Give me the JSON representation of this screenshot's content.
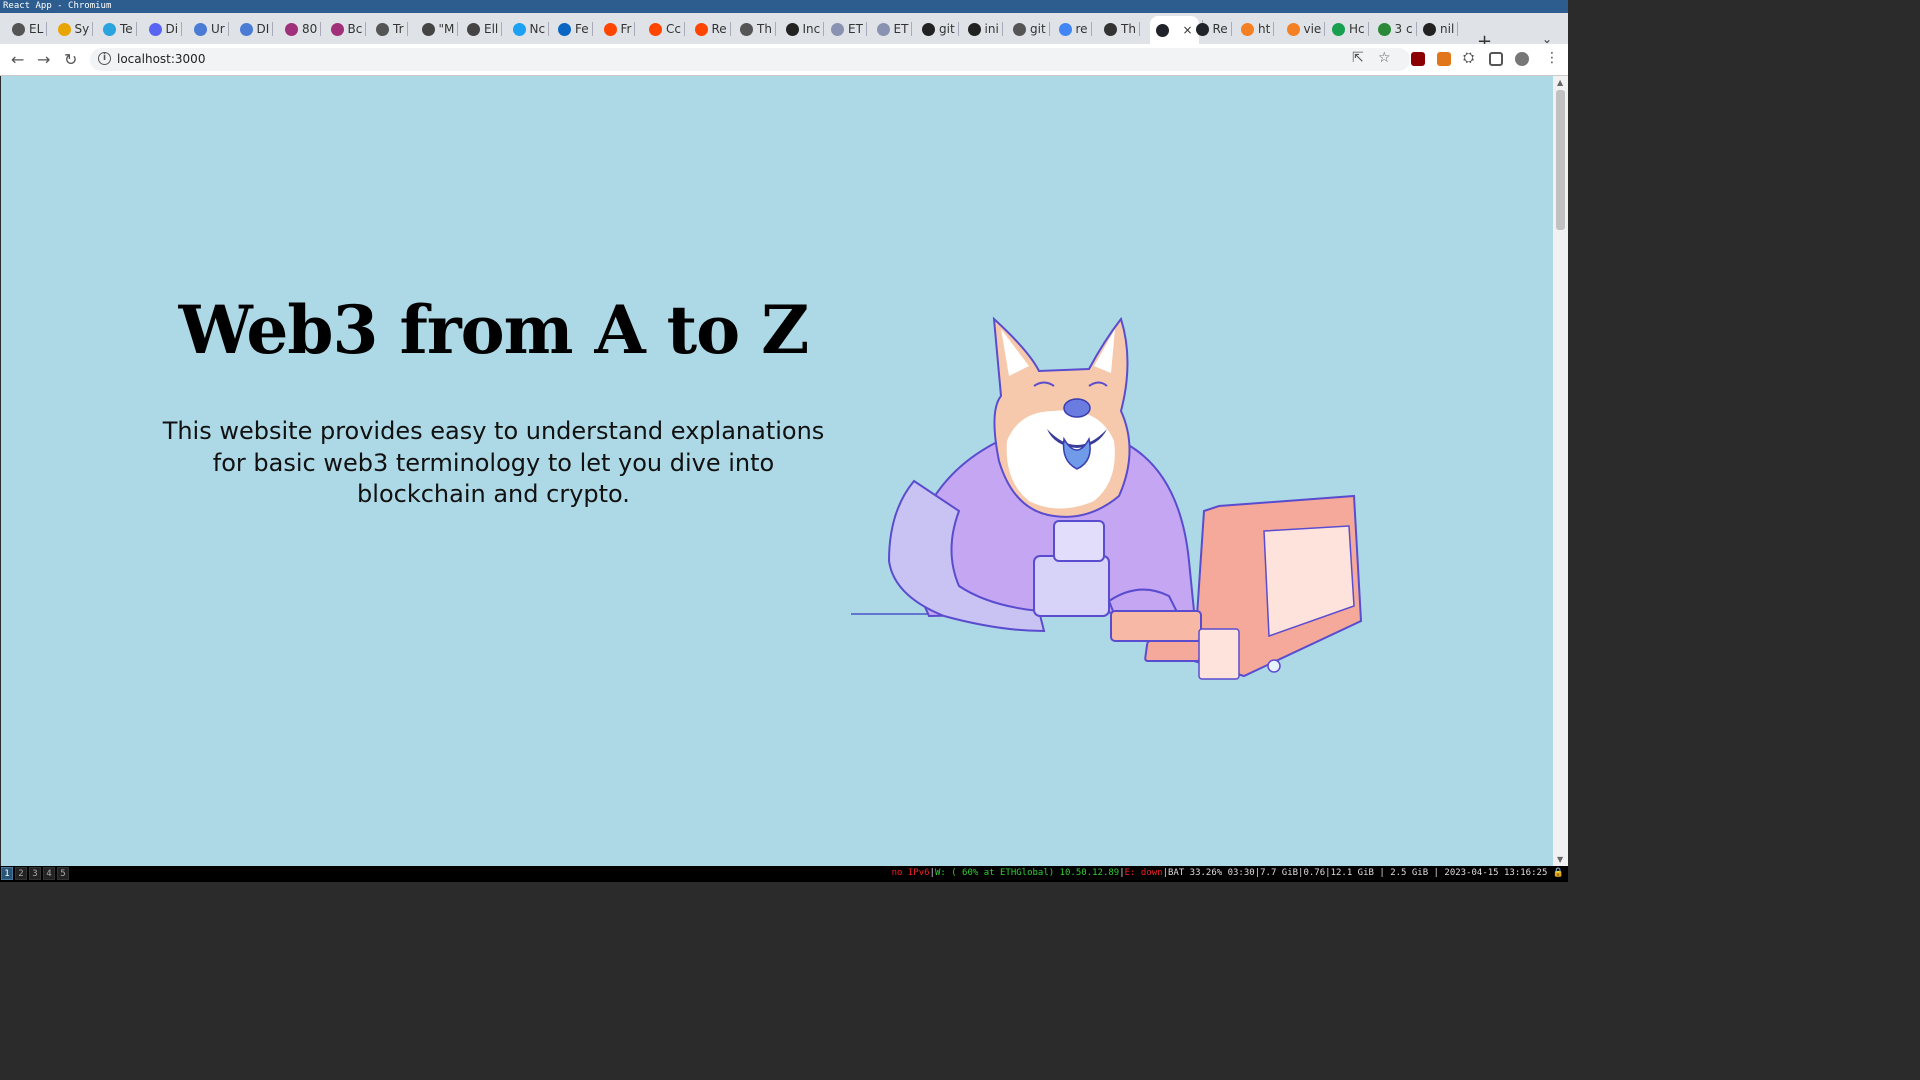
{
  "window": {
    "title": "React App - Chromium"
  },
  "tabs": [
    {
      "label": "EL",
      "fav": "globe-icon"
    },
    {
      "label": "Sy",
      "fav": "bird-icon"
    },
    {
      "label": "Te",
      "fav": "telegram-icon"
    },
    {
      "label": "Di",
      "fav": "discord-icon"
    },
    {
      "label": "Ur",
      "fav": "puzzle-icon"
    },
    {
      "label": "DI",
      "fav": "puzzle-icon"
    },
    {
      "label": "80",
      "fav": "jr-icon"
    },
    {
      "label": "Bc",
      "fav": "jr-icon"
    },
    {
      "label": "Tr",
      "fav": "globe-icon"
    },
    {
      "label": "\"M",
      "fav": "doc-icon"
    },
    {
      "label": "Ell",
      "fav": "doc-icon"
    },
    {
      "label": "Nc",
      "fav": "twitter-icon"
    },
    {
      "label": "Fe",
      "fav": "linkedin-icon"
    },
    {
      "label": "Fr",
      "fav": "reddit-icon"
    },
    {
      "label": "Cc",
      "fav": "reddit-icon"
    },
    {
      "label": "Re",
      "fav": "reddit-icon"
    },
    {
      "label": "Th",
      "fav": "globe-icon"
    },
    {
      "label": "Inc",
      "fav": "github-icon"
    },
    {
      "label": "ET",
      "fav": "eth-icon"
    },
    {
      "label": "ET",
      "fav": "eth-icon"
    },
    {
      "label": "git",
      "fav": "github-icon"
    },
    {
      "label": "ini",
      "fav": "github-icon"
    },
    {
      "label": "git",
      "fav": "globe-icon"
    },
    {
      "label": "re",
      "fav": "google-icon"
    },
    {
      "label": "Th",
      "fav": "a-icon"
    },
    {
      "label": "",
      "fav": "react-icon",
      "active": true
    },
    {
      "label": "Re",
      "fav": "react-icon"
    },
    {
      "label": "ht",
      "fav": "stack-icon"
    },
    {
      "label": "vie",
      "fav": "stack-icon"
    },
    {
      "label": "Hc",
      "fav": "w-icon"
    },
    {
      "label": "3 c",
      "fav": "turtle-icon"
    },
    {
      "label": "nil",
      "fav": "github-icon"
    }
  ],
  "addressbar": {
    "url": "localhost:3000"
  },
  "hero": {
    "title": "Web3 from A to Z",
    "description": "This website provides easy to understand explanations for basic web3 terminology to let you dive into blockchain and crypto."
  },
  "statusbar": {
    "workspaces": [
      "1",
      "2",
      "3",
      "4",
      "5"
    ],
    "active_workspace": "1",
    "ipv6": "no IPv6",
    "wifi": "W: ( 60% at ETHGlobal) 10.50.12.89",
    "eth": "E: down",
    "battery": "BAT 33.26% 03:30",
    "mem": "7.7 GiB",
    "load": "0.76",
    "disk1": "12.1 GiB",
    "disk2": "2.5 GiB",
    "datetime": "2023-04-15 13:16:25"
  },
  "colors": {
    "page_bg": "#add8e6",
    "titlebar": "#2d5d8f"
  }
}
